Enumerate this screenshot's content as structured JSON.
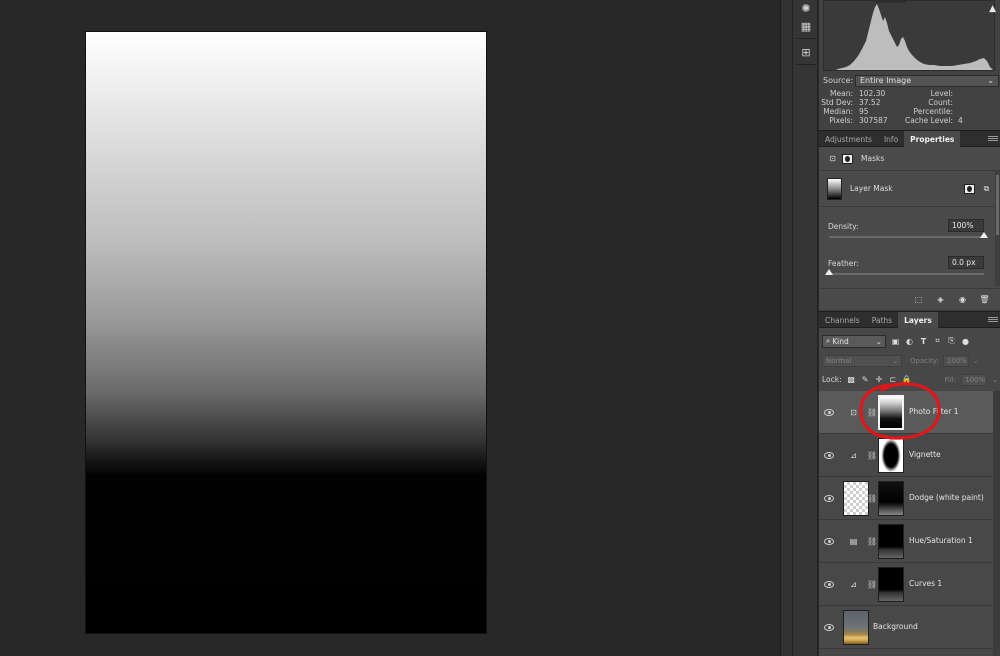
{
  "colors": {
    "annotation": "#e0161b",
    "selected_row": "#5a5a5a",
    "panel_bg": "#474747"
  },
  "histogram": {
    "source_label": "Source:",
    "source_value": "Entire Image",
    "warning_icon": "alert-triangle-icon",
    "stats": {
      "mean_label": "Mean:",
      "mean_value": "102.30",
      "stddev_label": "Std Dev:",
      "stddev_value": "37.52",
      "median_label": "Median:",
      "median_value": "95",
      "pixels_label": "Pixels:",
      "pixels_value": "307587",
      "level_label": "Level:",
      "level_value": "",
      "count_label": "Count:",
      "count_value": "",
      "percentile_label": "Percentile:",
      "percentile_value": "",
      "cache_label": "Cache Level:",
      "cache_value": "4"
    }
  },
  "properties_tabs": [
    "Adjustments",
    "Info",
    "Properties"
  ],
  "properties": {
    "header_label": "Masks",
    "mask_label": "Layer Mask",
    "density_label": "Density:",
    "density_value": "100%",
    "density_level": 1.0,
    "feather_label": "Feather:",
    "feather_value": "0.0 px",
    "feather_level": 0.0
  },
  "layers_tabs": [
    "Channels",
    "Paths",
    "Layers"
  ],
  "layers": {
    "kind_label": "Kind",
    "blend_mode": "Normal",
    "opacity_label": "Opacity:",
    "opacity_value": "100%",
    "lock_label": "Lock:",
    "fill_label": "Fill:",
    "fill_value": "100%",
    "items": [
      {
        "name": "Photo Filter 1",
        "type": "adjustment",
        "icon": "photo-filter-icon",
        "selected": true
      },
      {
        "name": "Vignette",
        "type": "adjustment",
        "icon": "curves-icon",
        "selected": false
      },
      {
        "name": "Dodge (white paint)",
        "type": "pixel-with-mask",
        "icon": "",
        "selected": false
      },
      {
        "name": "Hue/Saturation 1",
        "type": "adjustment",
        "icon": "hue-saturation-icon",
        "selected": false
      },
      {
        "name": "Curves 1",
        "type": "adjustment",
        "icon": "curves-icon",
        "selected": false
      },
      {
        "name": "Background",
        "type": "background",
        "icon": "",
        "selected": false
      }
    ]
  }
}
